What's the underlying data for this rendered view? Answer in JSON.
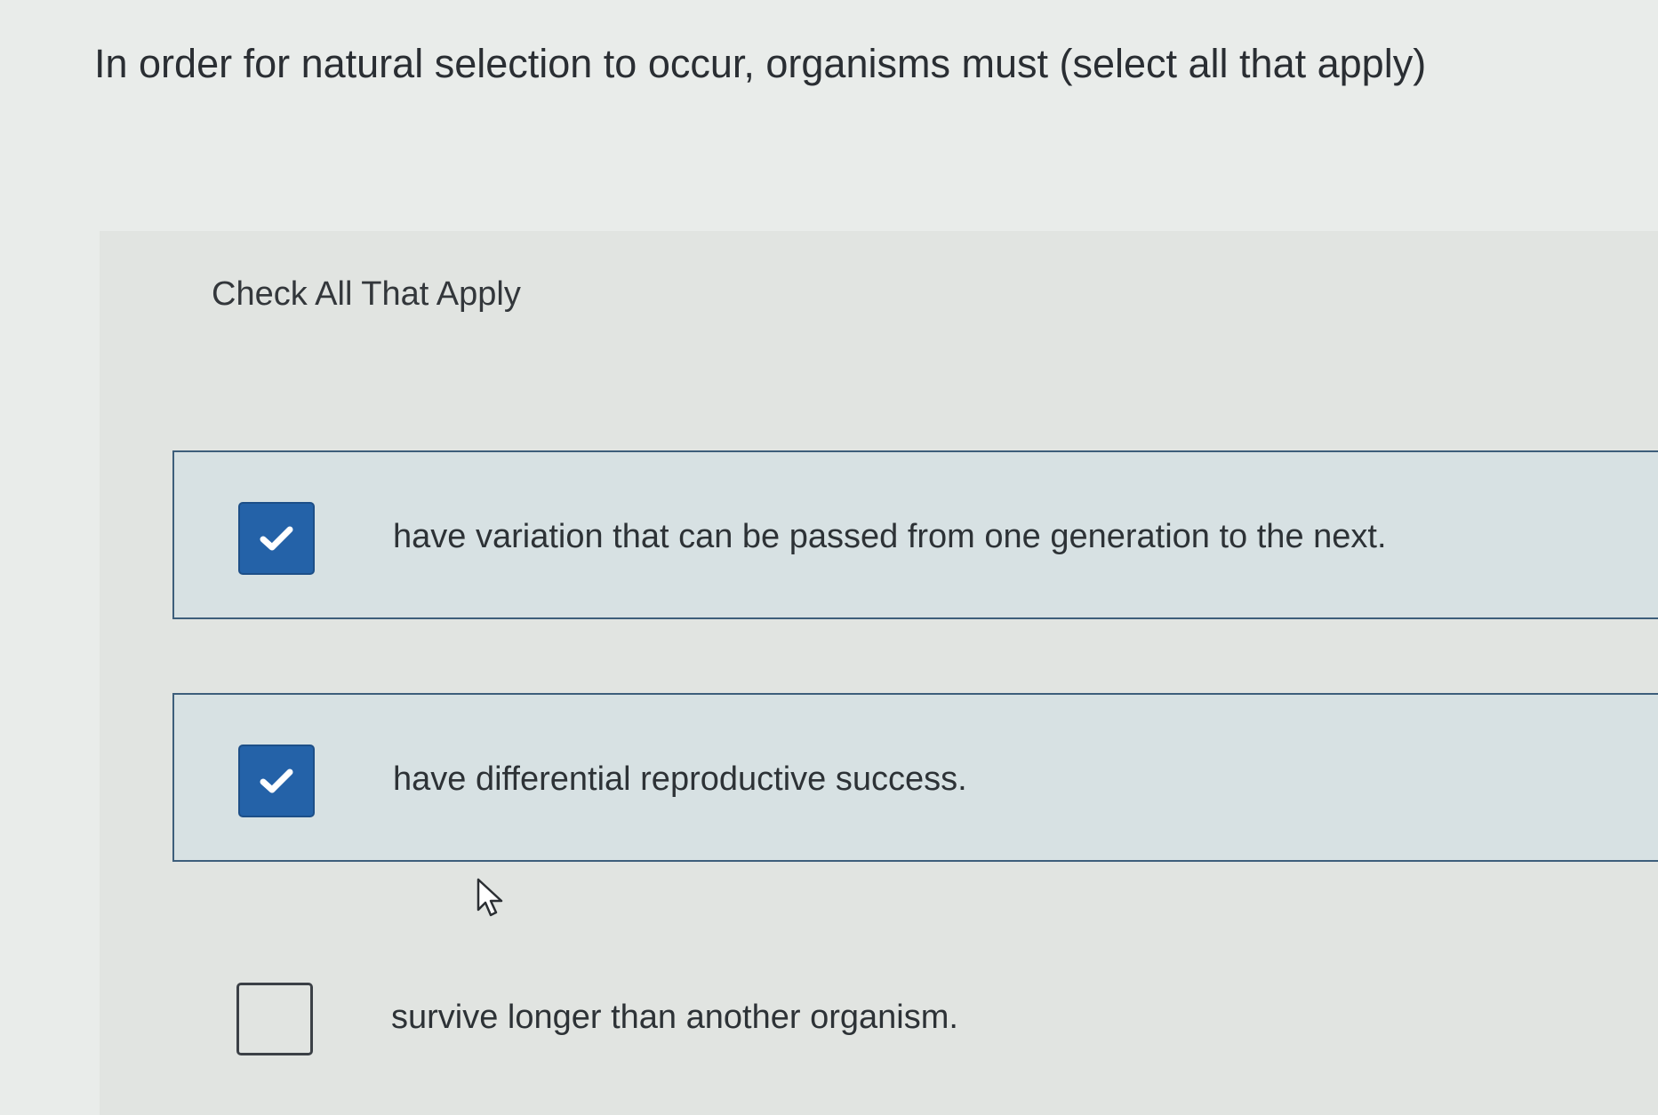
{
  "question": {
    "text": "In order for natural selection to occur, organisms must (select all that apply)"
  },
  "instruction": {
    "text": "Check All That Apply"
  },
  "options": [
    {
      "label": "have variation that can be passed from one generation to the next.",
      "checked": true
    },
    {
      "label": "have differential reproductive success.",
      "checked": true
    },
    {
      "label": "survive longer than another organism.",
      "checked": false
    }
  ],
  "colors": {
    "checkbox_checked": "#2462a8",
    "selected_row_background": "#d7e1e3",
    "selected_row_border": "#3d5e7b"
  },
  "icons": {
    "checkmark": "check-icon",
    "pointer": "mouse-pointer-icon"
  }
}
